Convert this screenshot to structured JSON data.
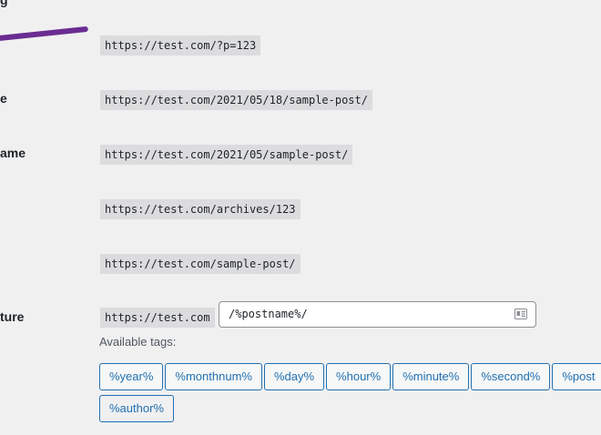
{
  "rows": [
    {
      "label": "",
      "url": "https://test.com/?p=123"
    },
    {
      "label": "e",
      "url": "https://test.com/2021/05/18/sample-post/"
    },
    {
      "label": "ame",
      "url": "https://test.com/2021/05/sample-post/"
    },
    {
      "label": "",
      "url": "https://test.com/archives/123"
    },
    {
      "label": "",
      "url": "https://test.com/sample-post/"
    }
  ],
  "custom": {
    "label": "ture",
    "base": "https://test.com",
    "value": "/%postname%/",
    "input_icon": "id-card-icon"
  },
  "available_label": "Available tags:",
  "tags": [
    "%year%",
    "%monthnum%",
    "%day%",
    "%hour%",
    "%minute%",
    "%second%",
    "%post",
    "%author%"
  ],
  "colors": {
    "accent": "#2271b1",
    "annotation": "#6a2c91"
  }
}
